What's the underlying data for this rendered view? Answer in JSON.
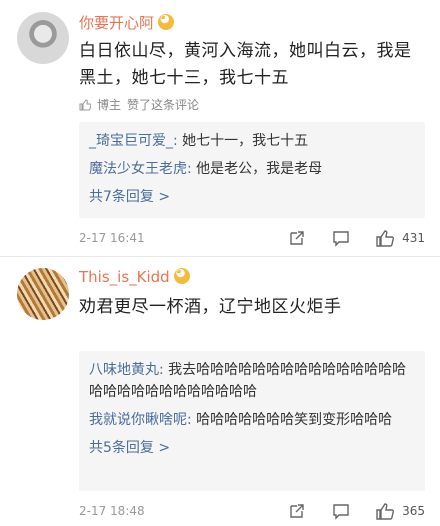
{
  "comments": [
    {
      "username": "你要开心阿",
      "text": "白日依山尽，黄河入海流，她叫白云，我是黑土，她七十三，我七十五",
      "meta": {
        "author_label": "博主",
        "liked_label": "赞了这条评论"
      },
      "replies": [
        {
          "name": "_琦宝巨可爱_:",
          "text": " 她七十一，我七十五"
        },
        {
          "name": "魔法少女王老虎:",
          "text": " 他是老公，我是老母"
        }
      ],
      "more_replies": "共7条回复 >",
      "time": "2-17 16:41",
      "likes": "431"
    },
    {
      "username": "This_is_Kidd",
      "text": "劝君更尽一杯酒，辽宁地区火炬手",
      "replies": [
        {
          "name": "八味地黄丸:",
          "text": " 我去哈哈哈哈哈哈哈哈哈哈哈哈哈哈哈哈哈哈哈哈哈哈哈哈哈哈哈"
        },
        {
          "name": "我就说你瞅啥呢:",
          "text": " 哈哈哈哈哈哈哈笑到变形哈哈哈"
        }
      ],
      "more_replies": "共5条回复 >",
      "time": "2-17 18:48",
      "likes": "365"
    }
  ]
}
